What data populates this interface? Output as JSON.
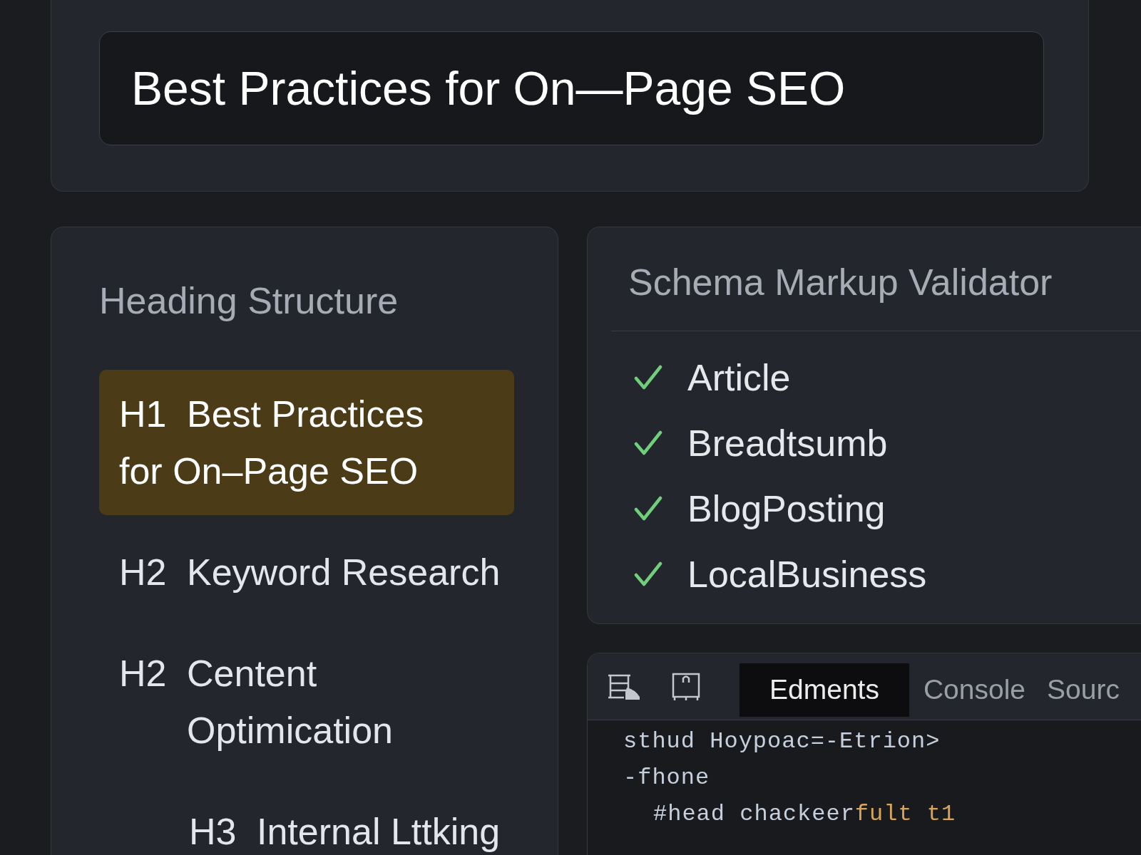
{
  "title_card": {
    "title_input": {
      "value": "Best Practices for On—Page SEO"
    }
  },
  "heading_structure": {
    "title": "Heading Structure",
    "items": [
      {
        "tag": "H1",
        "text": "Best Practices for On–Page SEO",
        "selected": true
      },
      {
        "tag": "H2",
        "text": "Keyword Research",
        "selected": false
      },
      {
        "tag": "H2",
        "text": "Centent Optimication",
        "selected": false,
        "children": [
          {
            "tag": "H3",
            "text": "Internal Lttking",
            "selected": false
          }
        ]
      }
    ]
  },
  "schema_validator": {
    "title": "Schema Markup Validator",
    "items": [
      {
        "label": "Article",
        "valid": true
      },
      {
        "label": "Breadtsumb",
        "valid": true
      },
      {
        "label": "BlogPosting",
        "valid": true
      },
      {
        "label": "LocalBusiness",
        "valid": true
      }
    ]
  },
  "devtools": {
    "tabs": [
      {
        "label": "Edments",
        "selected": true
      },
      {
        "label": "Console",
        "selected": false
      },
      {
        "label": "Sourc",
        "selected": false
      }
    ],
    "code_lines": [
      {
        "tokens": [
          {
            "kind": "plain",
            "text": "sthud Hoypoac=-Etrion>"
          }
        ]
      },
      {
        "tokens": [
          {
            "kind": "plain",
            "text": "-fhone"
          }
        ],
        "children": [
          {
            "tokens": [
              {
                "kind": "plain",
                "text": "#head chackeer"
              },
              {
                "kind": "value",
                "text": "fult t1"
              }
            ]
          }
        ]
      }
    ]
  }
}
